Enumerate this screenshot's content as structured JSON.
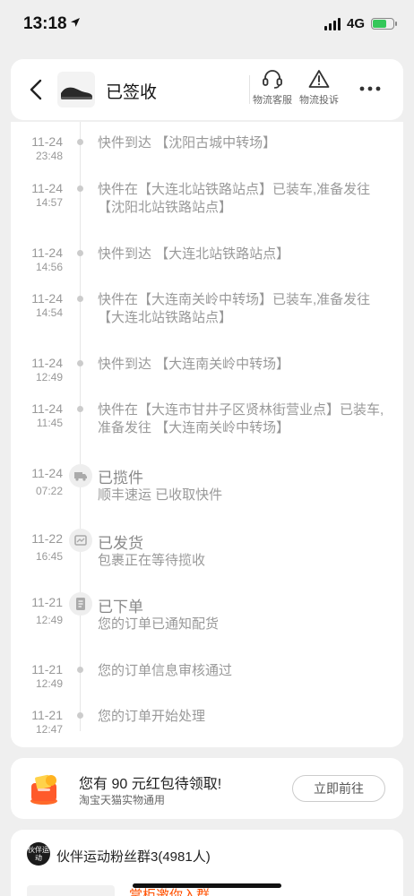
{
  "status_bar": {
    "time": "13:18",
    "network": "4G"
  },
  "header": {
    "status_title": "已签收",
    "actions": [
      {
        "label": "物流客服",
        "icon": "headset-icon"
      },
      {
        "label": "物流投诉",
        "icon": "warning-icon"
      }
    ]
  },
  "timeline": [
    {
      "date": "11-24",
      "time": "23:48",
      "text": "快件到达 【沈阳古城中转场】"
    },
    {
      "date": "11-24",
      "time": "14:57",
      "text": "快件在【大连北站铁路站点】已装车,准备发往 【沈阳北站铁路站点】"
    },
    {
      "date": "11-24",
      "time": "14:56",
      "text": "快件到达 【大连北站铁路站点】"
    },
    {
      "date": "11-24",
      "time": "14:54",
      "text": "快件在【大连南关岭中转场】已装车,准备发往 【大连北站铁路站点】"
    },
    {
      "date": "11-24",
      "time": "12:49",
      "text": "快件到达 【大连南关岭中转场】"
    },
    {
      "date": "11-24",
      "time": "11:45",
      "text": "快件在【大连市甘井子区贤林街营业点】已装车,准备发往 【大连南关岭中转场】"
    },
    {
      "date": "11-24",
      "time": "07:22",
      "title": "已揽件",
      "text": "顺丰速运 已收取快件",
      "icon": "truck-icon"
    },
    {
      "date": "11-22",
      "time": "16:45",
      "title": "已发货",
      "text": "包裹正在等待揽收",
      "icon": "package-icon"
    },
    {
      "date": "11-21",
      "time": "12:49",
      "title": "已下单",
      "text": "您的订单已通知配货",
      "icon": "order-icon"
    },
    {
      "date": "11-21",
      "time": "12:49",
      "text": "您的订单信息审核通过"
    },
    {
      "date": "11-21",
      "time": "12:47",
      "text": "您的订单开始处理"
    }
  ],
  "promo": {
    "title": "您有 90 元红包待领取!",
    "subtitle": "淘宝天猫实物通用",
    "button": "立即前往"
  },
  "group": {
    "name": "伙伴运动粉丝群3(4981人)",
    "avatar_text": "伙伴运动",
    "message": "掌柜邀你入群"
  },
  "colors": {
    "accent": "#ff5000",
    "background": "#efefef",
    "battery": "#34c759"
  }
}
